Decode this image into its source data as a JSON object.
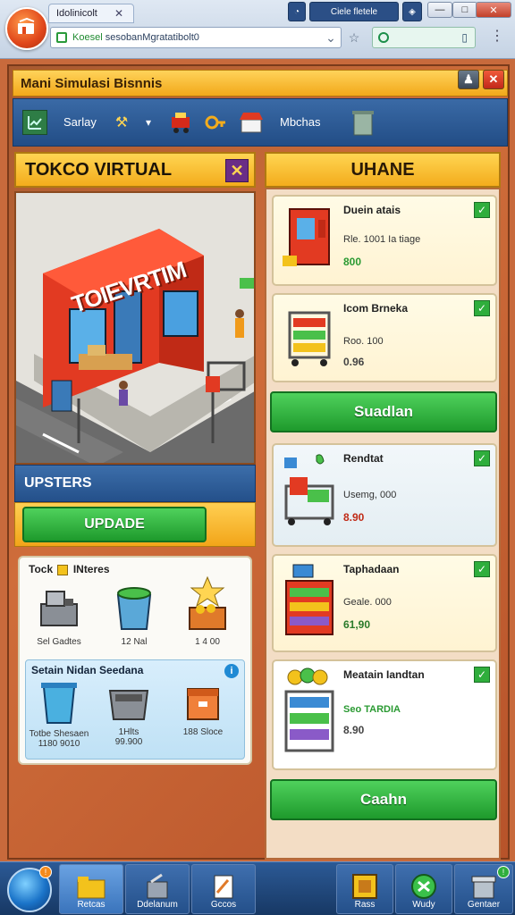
{
  "browser": {
    "tab_title": "Idolinicolt",
    "small_tab_label": "Ciele fletele",
    "address_prefix": "Koesel",
    "address_rest": "sesobanMgratatibolt0",
    "menu_glyph": "⋮"
  },
  "app": {
    "title": "Mani Simulasi Bisnnis",
    "toolbar": {
      "label_left": "Sarlay",
      "label_right": "Mbchas"
    }
  },
  "store_panel": {
    "title": "TOKCO VIRTUAL",
    "close_glyph": "✕",
    "sign_text": "TOIEVRTIM",
    "sub_header": "UPSTERS",
    "update_button": "UPDADE",
    "inventory": {
      "title": "Tock",
      "title_suffix": "INteres",
      "items": [
        {
          "label": "Sel Gadtes",
          "icon": "register-icon"
        },
        {
          "label": "12 Nal",
          "icon": "basket-icon"
        },
        {
          "label": "1 4 00",
          "icon": "crate-icon"
        }
      ],
      "subpanel": {
        "title": "Setain Nidan Seedana",
        "info_glyph": "i",
        "items": [
          {
            "label": "Totbe Shesaen",
            "value": "1180 9010",
            "icon": "bin-icon"
          },
          {
            "label": "1Hlts",
            "value": "99.900",
            "icon": "tray-icon"
          },
          {
            "label": "188 Sloce",
            "value": "",
            "icon": "box-icon"
          }
        ]
      }
    }
  },
  "upgrades_panel": {
    "title": "UHANE",
    "cards": [
      {
        "name": "Duein atais",
        "line1": "Rle. 1001 Ia tiage",
        "line2": "800",
        "icon": "vending-machine-icon"
      },
      {
        "name": "Icom Brneka",
        "line1": "Roo. 100",
        "line2": "0.96",
        "icon": "shelf-cart-icon"
      },
      {
        "name": "Rendtat",
        "line1": "Usemg, 000",
        "line2": "8.90",
        "icon": "produce-stand-icon"
      },
      {
        "name": "Taphadaan",
        "line1": "Geale. 000",
        "line2": "61,90",
        "icon": "display-shelf-icon"
      },
      {
        "name": "Meatain Iandtan",
        "line1": "Seo TARDIA",
        "line2": "8.90",
        "icon": "coin-shelf-icon"
      }
    ],
    "button_mid": "Suadlan",
    "button_bottom": "Caahn"
  },
  "taskbar": {
    "items": [
      {
        "label": "Retcas"
      },
      {
        "label": "Ddelanum"
      },
      {
        "label": "Gccos"
      },
      {
        "label": "Rass"
      },
      {
        "label": "Wudy"
      },
      {
        "label": "Gentaer"
      }
    ],
    "badge_glyph": "!"
  }
}
